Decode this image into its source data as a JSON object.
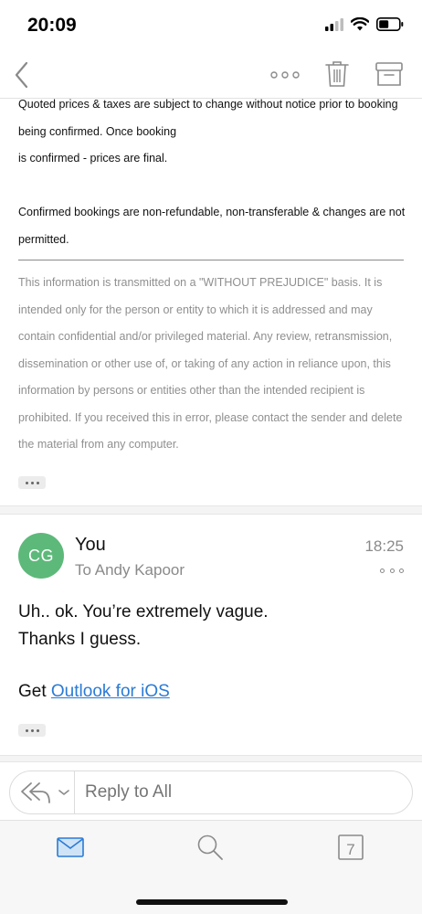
{
  "status_bar": {
    "time": "20:09"
  },
  "nav": {
    "icons": [
      "back-chevron-icon",
      "more-horizontal-icon",
      "trash-icon",
      "archive-icon"
    ]
  },
  "quoted": {
    "lines": [
      "Quoted prices & taxes are subject to change without notice prior to booking",
      "being confirmed. Once booking",
      "is confirmed - prices are final.",
      "Confirmed bookings are non-refundable, non-transferable & changes are not",
      "permitted."
    ],
    "disclaimer": [
      "This information is transmitted on a \"WITHOUT PREJUDICE\" basis. It is",
      "intended only for the person or entity to which it is addressed and may",
      "contain confidential and/or privileged material. Any review, retransmission,",
      "dissemination or other use of, or taking of any action in reliance upon, this",
      "information by persons or entities other than the intended recipient is",
      "prohibited. If you received this in error, please contact the sender and delete",
      "the material from any computer."
    ]
  },
  "message": {
    "avatar_initials": "CG",
    "sender": "You",
    "recipient": "To Andy Kapoor",
    "time": "18:25",
    "body_lines": [
      "Uh.. ok. You’re extremely vague.",
      "Thanks I guess."
    ],
    "signature_prefix": "Get ",
    "signature_link": "Outlook for iOS"
  },
  "reply": {
    "placeholder": "Reply to All"
  },
  "tabs": {
    "calendar_day": "7"
  },
  "colors": {
    "avatar": "#5db97a",
    "link": "#2a7bd6",
    "accent": "#2a7bd6"
  }
}
